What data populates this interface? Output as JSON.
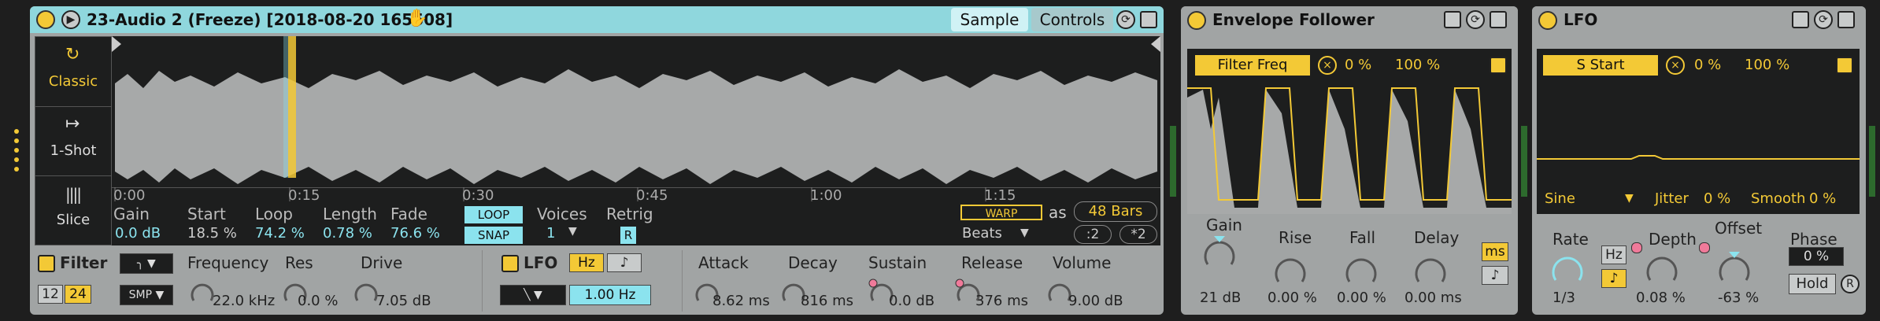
{
  "sampler": {
    "title": "23-Audio 2 (Freeze) [2018-08-20 165508]",
    "tab_sample": "Sample",
    "tab_controls": "Controls",
    "modes": [
      "Classic",
      "1-Shot",
      "Slice"
    ],
    "timeline": [
      "0:00",
      "0:15",
      "0:30",
      "0:45",
      "1:00",
      "1:15"
    ],
    "params": {
      "gain_label": "Gain",
      "gain_value": "0.0 dB",
      "start_label": "Start",
      "start_value": "18.5 %",
      "loop_label": "Loop",
      "loop_value": "74.2 %",
      "length_label": "Length",
      "length_value": "0.78 %",
      "fade_label": "Fade",
      "fade_value": "76.6 %",
      "loop_btn": "LOOP",
      "snap_btn": "SNAP",
      "voices_label": "Voices",
      "voices_value": "1",
      "retrig_label": "Retrig",
      "retrig_btn": "R"
    },
    "warp": {
      "warp_btn": "WARP",
      "as_label": "as",
      "bars_value": "48 Bars",
      "mode_value": "Beats",
      "half_btn": ":2",
      "double_btn": "*2"
    },
    "filter": {
      "label": "Filter",
      "slope_12": "12",
      "slope_24": "24",
      "type_value": "SMP",
      "freq_label": "Frequency",
      "freq_value": "22.0 kHz",
      "res_label": "Res",
      "res_value": "0.0 %",
      "drive_label": "Drive",
      "drive_value": "7.05 dB"
    },
    "lfo": {
      "label": "LFO",
      "hz_btn": "Hz",
      "note_btn": "♪",
      "rate_value": "1.00",
      "rate_unit": "Hz"
    },
    "env": {
      "attack_label": "Attack",
      "attack_value": "8.62 ms",
      "decay_label": "Decay",
      "decay_value": "816 ms",
      "sustain_label": "Sustain",
      "sustain_value": "0.0 dB",
      "release_label": "Release",
      "release_value": "376 ms",
      "volume_label": "Volume",
      "volume_value": "9.00 dB"
    }
  },
  "envelope_follower": {
    "title": "Envelope Follower",
    "target": "Filter Freq",
    "min": "0 %",
    "max": "100 %",
    "gain_label": "Gain",
    "gain_value": "21 dB",
    "rise_label": "Rise",
    "rise_value": "0.00 %",
    "fall_label": "Fall",
    "fall_value": "0.00 %",
    "delay_label": "Delay",
    "delay_value": "0.00 ms",
    "ms_btn": "ms",
    "note_btn": "♪"
  },
  "lfo_device": {
    "title": "LFO",
    "target": "S Start",
    "min": "0 %",
    "max": "100 %",
    "shape_value": "Sine",
    "jitter_label": "Jitter",
    "jitter_value": "0 %",
    "smooth_label": "Smooth",
    "smooth_value": "0 %",
    "rate_label": "Rate",
    "rate_value": "1/3",
    "hz_btn": "Hz",
    "note_btn": "♪",
    "depth_label": "Depth",
    "depth_value": "0.08 %",
    "offset_label": "Offset",
    "offset_value": "-63 %",
    "phase_label": "Phase",
    "phase_value": "0 %",
    "hold_btn": "Hold",
    "r_btn": "R"
  },
  "colors": {
    "accent": "#f3c936",
    "cyan": "#8be3ee",
    "panel": "#a1a4a4",
    "display": "#1d1e1e"
  }
}
